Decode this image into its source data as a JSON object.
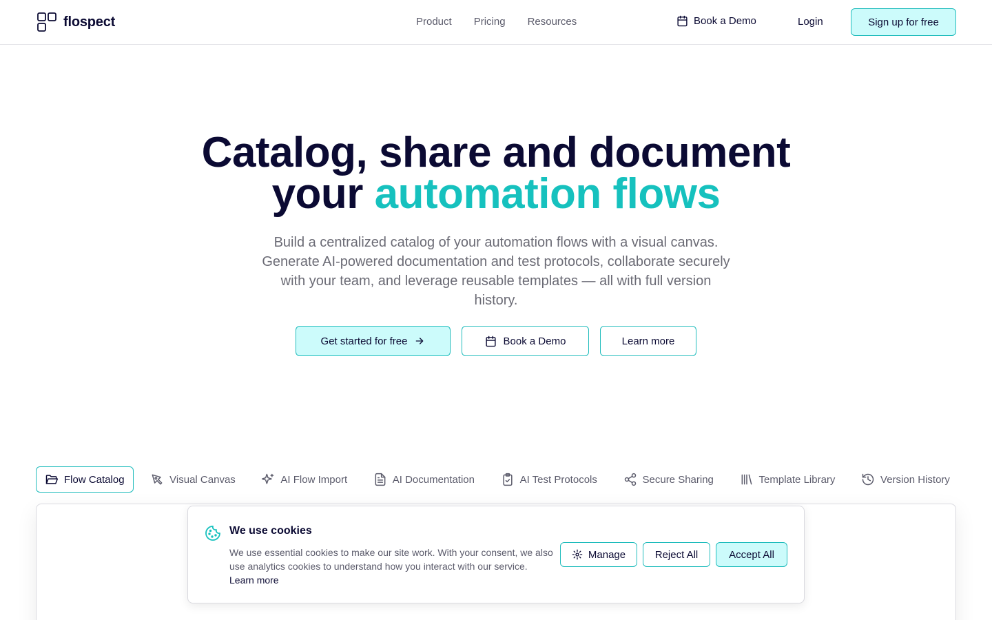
{
  "header": {
    "brand": "flospect",
    "nav": [
      "Product",
      "Pricing",
      "Resources"
    ],
    "book_demo": "Book a Demo",
    "login": "Login",
    "signup": "Sign up for free"
  },
  "hero": {
    "title_line1": "Catalog, share and document",
    "title_line2_plain": "your",
    "title_line2_accent": "automation flows",
    "subtitle": "Build a centralized catalog of your automation flows with a visual canvas. Generate AI-powered documentation and test protocols, collaborate securely with your team, and leverage reusable templates — all with full version history.",
    "cta_primary": "Get started for free",
    "cta_demo": "Book a Demo",
    "cta_learn": "Learn more"
  },
  "tabs": [
    {
      "label": "Flow Catalog",
      "icon": "folder-open-icon"
    },
    {
      "label": "Visual Canvas",
      "icon": "pen-tool-icon"
    },
    {
      "label": "AI Flow Import",
      "icon": "sparkles-icon"
    },
    {
      "label": "AI Documentation",
      "icon": "file-text-icon"
    },
    {
      "label": "AI Test Protocols",
      "icon": "clipboard-check-icon"
    },
    {
      "label": "Secure Sharing",
      "icon": "share-icon"
    },
    {
      "label": "Template Library",
      "icon": "library-icon"
    },
    {
      "label": "Version History",
      "icon": "history-icon"
    }
  ],
  "cookie": {
    "title": "We use cookies",
    "text": "We use essential cookies to make our site work. With your consent, we also use analytics cookies to understand how you interact with our service.",
    "learn_more": "Learn more",
    "manage": "Manage",
    "reject": "Reject All",
    "accept": "Accept All"
  },
  "colors": {
    "accent": "#16c1be",
    "accent_bg": "#ccfbfb",
    "border_accent": "#1fbcbc",
    "text_dark": "#0b0a33",
    "text_muted": "#5b5b6b"
  }
}
